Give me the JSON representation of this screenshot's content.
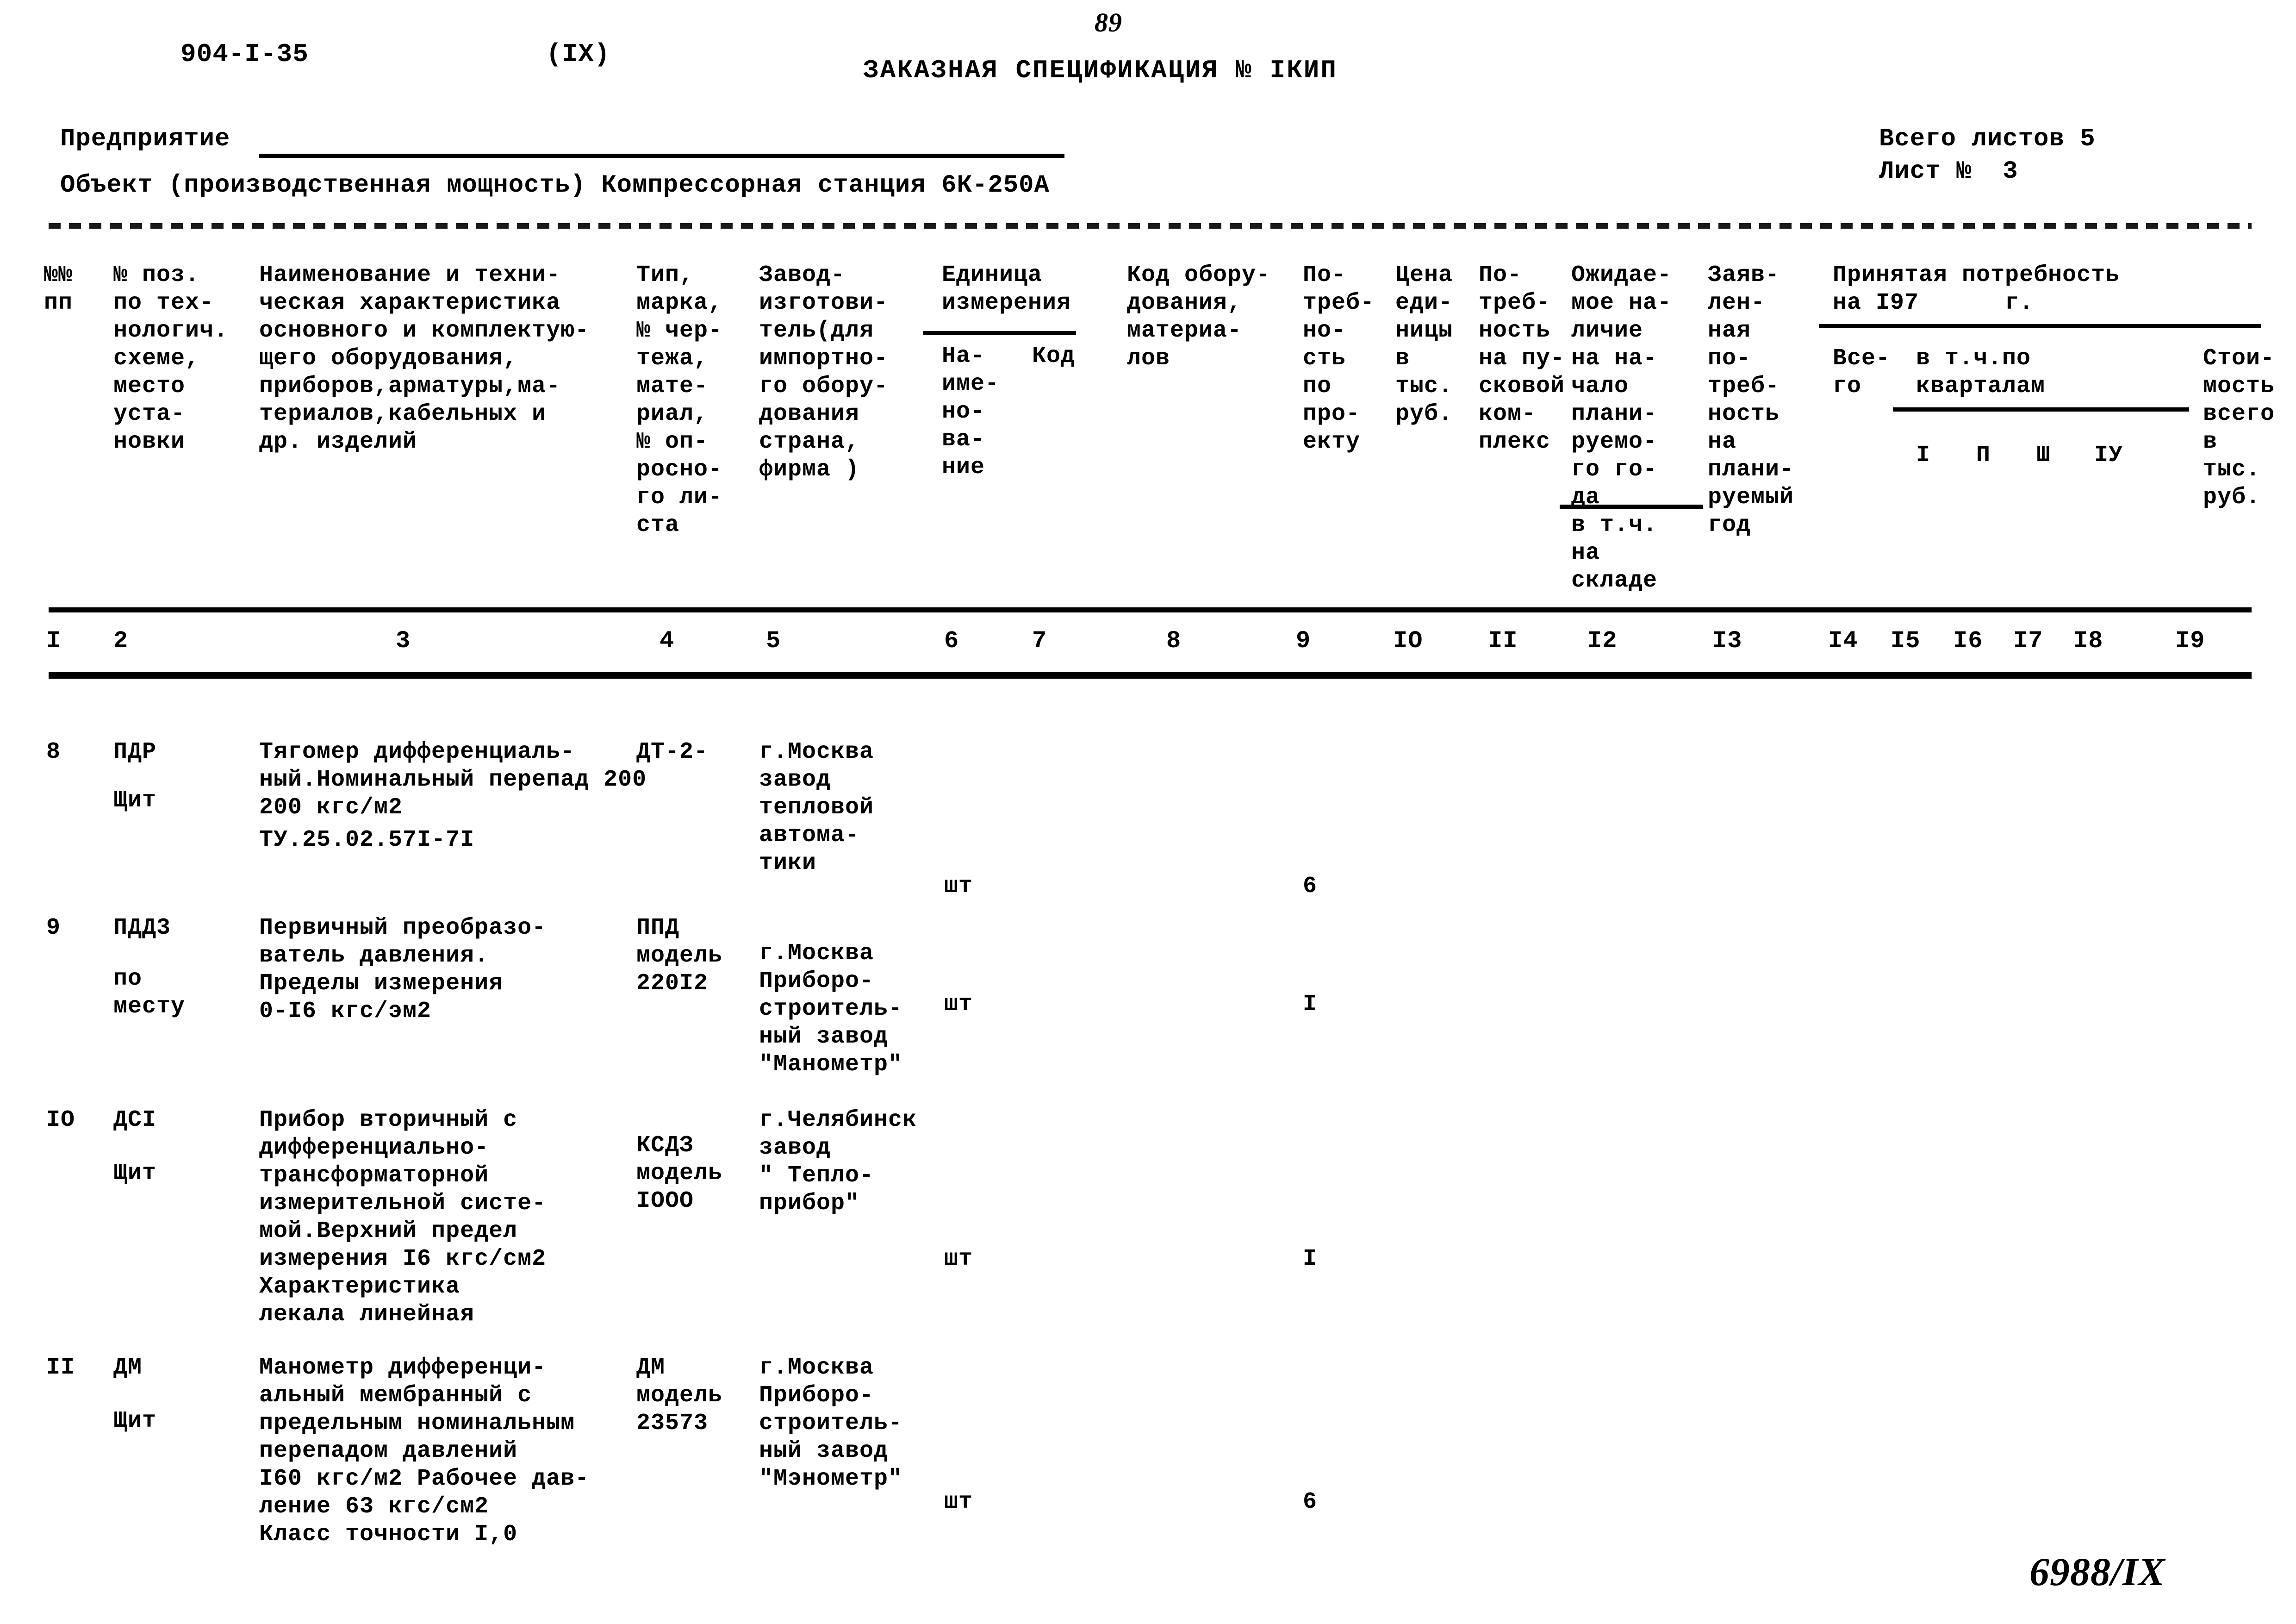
{
  "document": {
    "doc_code": "904-I-35",
    "section_code": "(IX)",
    "page_number": "89",
    "title": "ЗАКАЗНАЯ СПЕЦИФИКАЦИЯ № IКИП",
    "stamp": "6988/IX"
  },
  "header": {
    "enterprise_label": "Предприятие",
    "object_line": "Объект (производственная мощность) Компрессорная станция 6К-250А",
    "sheets_total": "Всего листов 5",
    "sheet_number": "Лист №  3"
  },
  "columns": {
    "nn": "№№\nпп",
    "position": "№ поз.\nпо тех-\nнологич.\nсхеме,\nместо\nуста-\nновки",
    "name": "Наименование и техни-\nческая характеристика\nосновного и комплектую-\nщего оборудования,\nприборов,арматуры,ма-\nтериалов,кабельных и\nдр. изделий",
    "type": "Тип,\nмарка,\n№ чер-\nтежа,\nмате-\nриал,\n№ оп-\nросно-\nго ли-\nста",
    "maker": "Завод-\nизготови-\nтель(для\nимпортно-\nго обору-\nдования\nстрана,\nфирма )",
    "unit": "Единица\nизмерения",
    "unit_name": "На-\nиме-\nно-\nва-\nние",
    "unit_code": "Код",
    "equip_code": "Код обору-\nдования,\nматериа-\nлов",
    "need_project": "По-\nтреб-\nно-\nсть\nпо\nпро-\nекту",
    "unit_price": "Цена\nеди-\nницы\nв\nтыс.\nруб.",
    "need_startup": "По-\nтреб-\nность\nна пу-\nсковой\nком-\nплекс",
    "expected_stock": "Ожидае-\nмое на-\nличие\nна на-\nчало\nплани-\nруемо-\nго го-\nда",
    "expected_stock_sub": "в т.ч.\nна\nскладе",
    "declared_need": "Заяв-\nлен-\nная\nпо-\nтреб-\nность\nна\nплани-\nруемый\nгод",
    "accepted_need": "Принятая потребность\nна I97      г.",
    "accepted_total": "Все-\nго",
    "accepted_quarters": "в т.ч.по\nкварталам",
    "quarter_labels": [
      "I",
      "П",
      "Ш",
      "IУ"
    ],
    "cost_total": "Стои-\nмость\nвсего\nв\nтыс.\nруб."
  },
  "column_numbers": [
    "I",
    "2",
    "3",
    "4",
    "5",
    "6",
    "7",
    "8",
    "9",
    "IO",
    "II",
    "I2",
    "I3",
    "I4",
    "I5",
    "I6",
    "I7",
    "I8",
    "I9"
  ],
  "rows": [
    {
      "nn": "8",
      "position": "ПДР",
      "position2": "Щит",
      "name": "Тягомер дифференциаль-\nный.Номинальный перепад 200\n200 кгс/м2",
      "name2": "ТУ.25.02.57I-7I",
      "type": "ДТ-2-",
      "maker": "г.Москва\nзавод\nтепловой\nавтома-\nтики",
      "unit": "шт",
      "need_project": "6"
    },
    {
      "nn": "9",
      "position": "ПДД3",
      "position2": "по\nместу",
      "name": "Первичный преобразо-\nватель давления.\nПределы измерения\n0-I6 кгс/эм2",
      "name2": "",
      "type": "ППД\nмодель\n220I2",
      "maker": "г.Москва\nПриборо-\nстроитель-\nный завод\n\"Манометр\"",
      "unit": "шт",
      "need_project": "I"
    },
    {
      "nn": "IO",
      "position": "ДСI",
      "position2": "Щит",
      "name": "Прибор вторичный с\nдифференциально-\nтрансформаторной\nизмерительной систе-\nмой.Верхний предел\nизмерения I6 кгс/см2\nХарактеристика\nлекала линейная",
      "name2": "",
      "type": "КСДЗ\nмодель\nIOOO",
      "maker": "г.Челябинск\nзавод\n\" Тепло-\nприбор\"",
      "unit": "шт",
      "need_project": "I"
    },
    {
      "nn": "II",
      "position": "ДМ",
      "position2": "Щит",
      "name": "Манометр дифференци-\nальный мембранный с\nпредельным номинальным\nперепадом давлений\nI60 кгс/м2 Рабочее дав-\nление 63 кгс/см2\nКласс точности I,0",
      "name2": "",
      "type": "ДМ\nмодель\n23573",
      "maker": "г.Москва\nПриборо-\nстроитель-\nный завод\n\"Мэнометр\"",
      "unit": "шт",
      "need_project": "6"
    }
  ]
}
